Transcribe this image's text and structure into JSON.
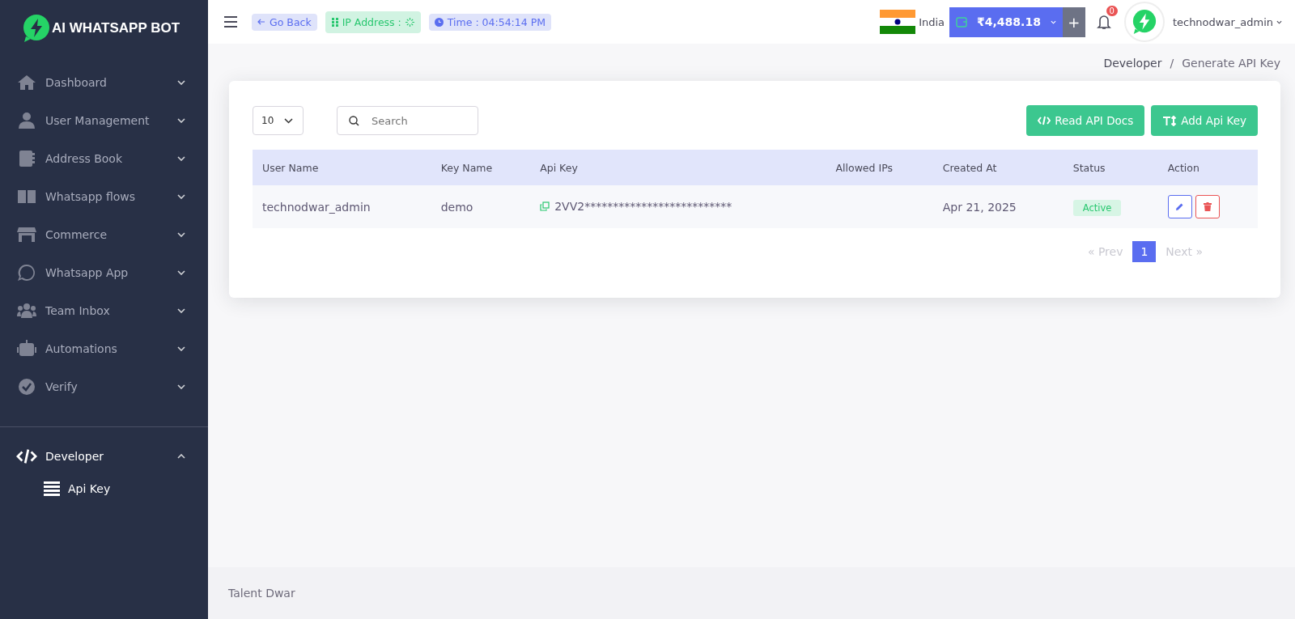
{
  "brand": {
    "name": "AI WHATSAPP BOT"
  },
  "sidebar": {
    "items": [
      {
        "label": "Dashboard",
        "expanded": false,
        "selected": false
      },
      {
        "label": "User Management",
        "expanded": false,
        "selected": false
      },
      {
        "label": "Address Book",
        "expanded": false,
        "selected": false
      },
      {
        "label": "Whatsapp flows",
        "expanded": false,
        "selected": false
      },
      {
        "label": "Commerce",
        "expanded": false,
        "selected": false
      },
      {
        "label": "Whatsapp App",
        "expanded": false,
        "selected": false
      },
      {
        "label": "Team Inbox",
        "expanded": false,
        "selected": false
      },
      {
        "label": "Automations",
        "expanded": false,
        "selected": false
      },
      {
        "label": "Verify",
        "expanded": false,
        "selected": false
      }
    ],
    "developer": {
      "label": "Developer",
      "expanded": true,
      "selected": true,
      "children": [
        {
          "label": "Api Key",
          "selected": true
        }
      ]
    }
  },
  "header": {
    "go_back": "Go Back",
    "ip_label": "IP Address :",
    "time": "Time : 04:54:14 PM",
    "country": "India",
    "balance": "₹4,488.18",
    "add": "+",
    "notifications": "0",
    "user": "technodwar_admin"
  },
  "breadcrumb": {
    "items": [
      "Developer",
      "Generate API Key"
    ],
    "separator": "/"
  },
  "toolbar": {
    "page_size": "10",
    "search_placeholder": "Search",
    "buttons": [
      "Read API Docs",
      "Add Api Key"
    ]
  },
  "table": {
    "columns": [
      "User Name",
      "Key Name",
      "Api Key",
      "Allowed IPs",
      "Created At",
      "Status",
      "Action"
    ],
    "rows": [
      {
        "user_name": "technodwar_admin",
        "key_name": "demo",
        "api_key": "2VV2**************************",
        "created_at": "Apr 21, 2025",
        "status": "Active"
      }
    ]
  },
  "pagination": {
    "prev": "« Prev",
    "pages": [
      {
        "label": "1",
        "selected": true
      }
    ],
    "next": "Next »",
    "prev_disabled": true,
    "next_disabled": true
  },
  "footer": "Talent Dwar"
}
